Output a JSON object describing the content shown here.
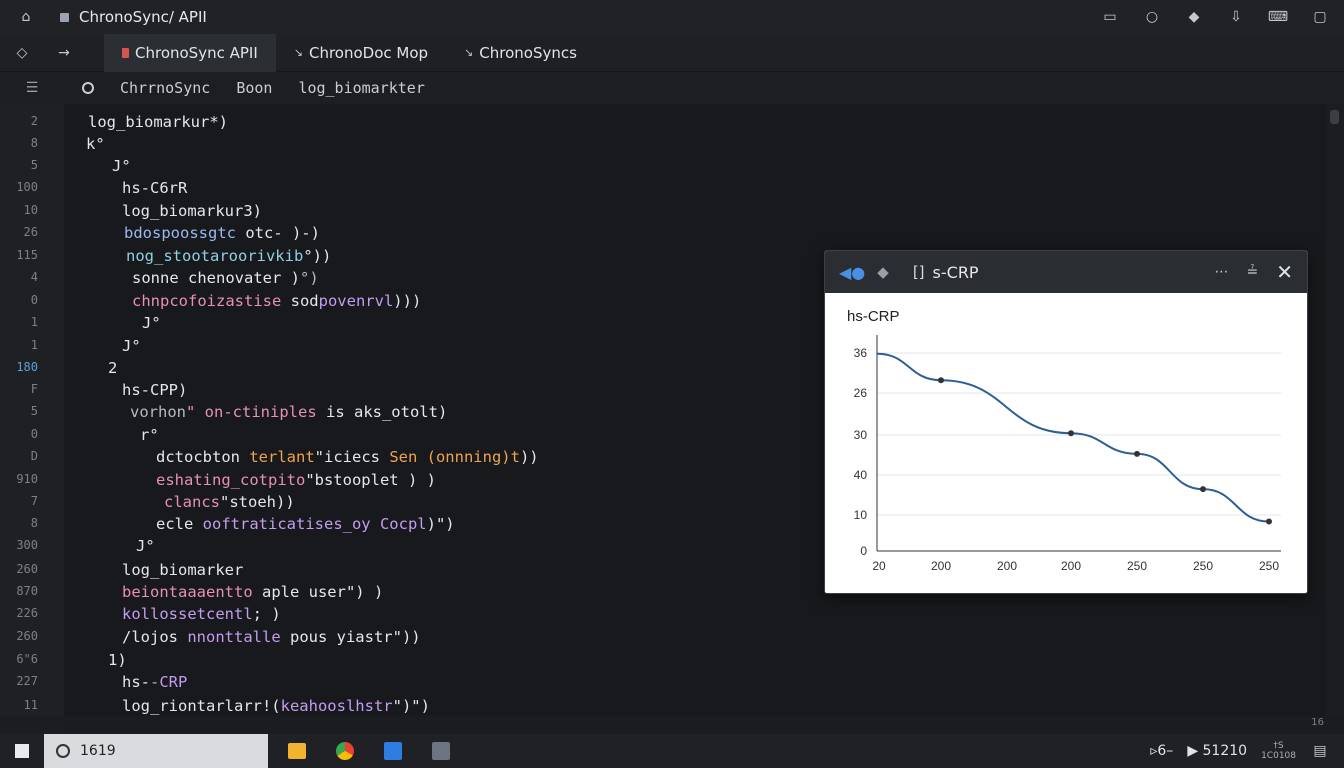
{
  "window": {
    "title": "ChronoSync/ APII",
    "controls": [
      "minimize-icon",
      "circle-icon",
      "diamond-icon",
      "download-icon",
      "comment-icon",
      "window-icon"
    ]
  },
  "tabs": [
    {
      "label": "ChronoSync APII",
      "icon": "file-icon",
      "active": true
    },
    {
      "label": "ChronoDoc Mop",
      "icon": "pin-icon",
      "active": false
    },
    {
      "label": "ChronoSyncs",
      "icon": "pin-icon",
      "active": false
    }
  ],
  "breadcrumb": {
    "items": [
      "ChrrnoSync",
      "Boon",
      "log_biomarkter"
    ]
  },
  "gutter": [
    "2",
    "8",
    "5",
    "100",
    "10",
    "26",
    "115",
    "4",
    "0",
    "1",
    "1",
    "180",
    "F",
    "5",
    "0",
    "D",
    "910",
    "7",
    "8",
    "300",
    "260",
    "870",
    "226",
    "260",
    "6\"6",
    "227",
    "11"
  ],
  "code": [
    [
      {
        "t": "log_biomarkur*)",
        "c": "c-white"
      }
    ],
    [
      {
        "t": "k°",
        "c": "c-white"
      }
    ],
    [
      {
        "t": "J°",
        "c": "c-white"
      }
    ],
    [
      {
        "t": "hs-C6rR",
        "c": "c-white"
      }
    ],
    [
      {
        "t": "log_biomarkur3)",
        "c": "c-white"
      }
    ],
    [
      {
        "t": "bdospoossgtc",
        "c": "c-blue"
      },
      {
        "t": " otc- )-)",
        "c": "c-white"
      }
    ],
    [
      {
        "t": "nog_stootaroorivkib",
        "c": "c-teal"
      },
      {
        "t": "°))",
        "c": "c-white"
      }
    ],
    [
      {
        "t": "sonne chenovater )",
        "c": "c-white"
      },
      {
        "t": "°)",
        "c": "c-grey"
      }
    ],
    [
      {
        "t": "chnpcofoizastise",
        "c": "c-pink"
      },
      {
        "t": " sod",
        "c": "c-white"
      },
      {
        "t": "povenrvl",
        "c": "c-violet"
      },
      {
        "t": ")))",
        "c": "c-white"
      }
    ],
    [
      {
        "t": "J°",
        "c": "c-white"
      }
    ],
    [
      {
        "t": "J°",
        "c": "c-white"
      }
    ],
    [
      {
        "t": "2",
        "c": "c-white"
      }
    ],
    [
      {
        "t": "hs-CPP)",
        "c": "c-white"
      }
    ],
    [
      {
        "t": "vorhon",
        "c": "c-grey"
      },
      {
        "t": "\" on-ctiniples",
        "c": "c-pink"
      },
      {
        "t": " is aks_otolt)",
        "c": "c-white"
      }
    ],
    [
      {
        "t": "r°",
        "c": "c-white"
      }
    ],
    [
      {
        "t": "dctocbton ",
        "c": "c-white"
      },
      {
        "t": "terlant",
        "c": "c-orange"
      },
      {
        "t": "\"iciecs ",
        "c": "c-white"
      },
      {
        "t": "Sen (onnning)t",
        "c": "c-orange"
      },
      {
        "t": "))",
        "c": "c-white"
      }
    ],
    [
      {
        "t": "eshating_cotpito",
        "c": "c-pink"
      },
      {
        "t": "\"bstooplet ) )",
        "c": "c-white"
      }
    ],
    [
      {
        "t": "clancs",
        "c": "c-pink"
      },
      {
        "t": "\"stoeh))",
        "c": "c-white"
      }
    ],
    [
      {
        "t": "ecle ",
        "c": "c-white"
      },
      {
        "t": "ooftraticatises_oy Cocpl",
        "c": "c-violet"
      },
      {
        "t": ")\")",
        "c": "c-white"
      }
    ],
    [
      {
        "t": "J°",
        "c": "c-white"
      }
    ],
    [
      {
        "t": "log_biomarker",
        "c": "c-white"
      }
    ],
    [
      {
        "t": "beiontaaaentto",
        "c": "c-pink"
      },
      {
        "t": " aple user\") )",
        "c": "c-white"
      }
    ],
    [
      {
        "t": "kollossetcentl",
        "c": "c-violet"
      },
      {
        "t": "; )",
        "c": "c-white"
      }
    ],
    [
      {
        "t": "/lojos ",
        "c": "c-white"
      },
      {
        "t": "nnonttalle",
        "c": "c-violet"
      },
      {
        "t": " pous yiastr\"))",
        "c": "c-white"
      }
    ],
    [
      {
        "t": "1)",
        "c": "c-white"
      }
    ],
    [
      {
        "t": "hs-",
        "c": "c-white"
      },
      {
        "t": "-CRP",
        "c": "c-violet"
      }
    ],
    [
      {
        "t": "log_riontarlarr!(",
        "c": "c-white"
      },
      {
        "t": "keahooslhstr",
        "c": "c-violet"
      },
      {
        "t": "\")\")",
        "c": "c-white"
      }
    ]
  ],
  "popup": {
    "title": "s-CRP",
    "bracket": "[]",
    "actions": [
      "more-icon",
      "minimize-icon",
      "close-icon"
    ]
  },
  "chart_data": {
    "type": "line",
    "title": "hs-CRP",
    "x": [
      "20",
      "200",
      "200",
      "200",
      "250",
      "250",
      "250"
    ],
    "values": [
      33.5,
      29,
      null,
      20,
      16.5,
      10.5,
      5
    ],
    "y_tick_labels": [
      "0",
      "10",
      "40",
      "30",
      "26",
      "36"
    ],
    "grid": true,
    "line_color": "#2c5f96"
  },
  "taskbar": {
    "search_text": "1619",
    "apps": [
      "folder-app",
      "chrome-app",
      "store-app",
      "terminal-app"
    ],
    "tray_left": "▹6–",
    "tray_time": "▶ 51210",
    "tray_small_top": "†S",
    "tray_small_bottom": "1C0108"
  },
  "hscroll_marker": "16"
}
